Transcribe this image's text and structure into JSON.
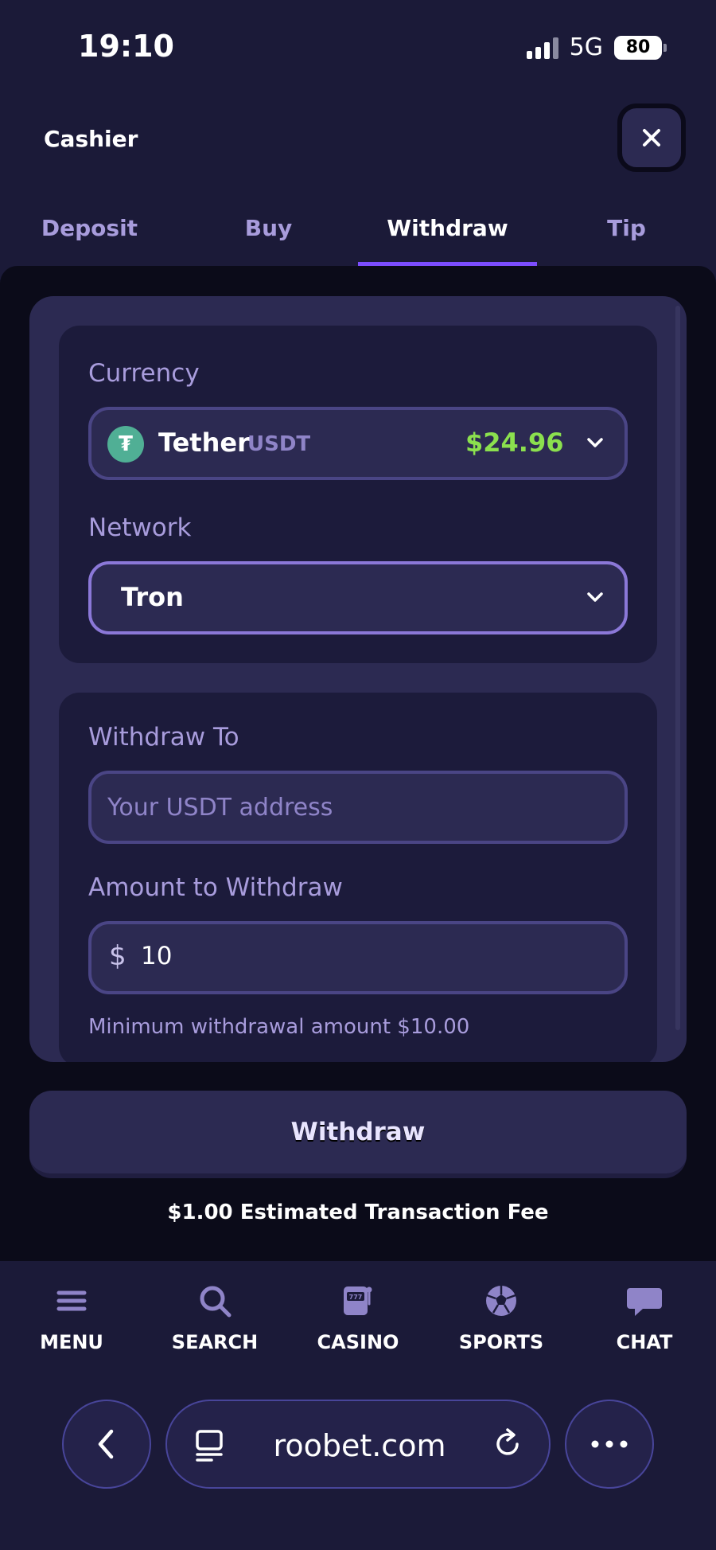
{
  "status_bar": {
    "time": "19:10",
    "network": "5G",
    "battery": "80"
  },
  "header": {
    "title": "Cashier"
  },
  "tabs": [
    {
      "label": "Deposit",
      "active": false
    },
    {
      "label": "Buy",
      "active": false
    },
    {
      "label": "Withdraw",
      "active": true
    },
    {
      "label": "Tip",
      "active": false
    }
  ],
  "currency": {
    "label": "Currency",
    "icon": "tether-icon",
    "icon_glyph": "₮",
    "name": "Tether",
    "ticker": "USDT",
    "balance": "$24.96"
  },
  "network": {
    "label": "Network",
    "value": "Tron"
  },
  "withdraw_to": {
    "label": "Withdraw To",
    "placeholder": "Your USDT address"
  },
  "amount": {
    "label": "Amount to Withdraw",
    "currency_symbol": "$",
    "value": "10"
  },
  "hint": "Minimum withdrawal amount $10.00",
  "withdraw_button": "Withdraw",
  "fee_text": "$1.00 Estimated Transaction Fee",
  "bottom_nav": [
    {
      "label": "MENU",
      "icon": "menu-icon"
    },
    {
      "label": "SEARCH",
      "icon": "search-icon"
    },
    {
      "label": "CASINO",
      "icon": "slot-machine-icon"
    },
    {
      "label": "SPORTS",
      "icon": "soccer-ball-icon"
    },
    {
      "label": "CHAT",
      "icon": "chat-icon"
    }
  ],
  "browser": {
    "url": "roobet.com"
  },
  "colors": {
    "background": "#1b1a38",
    "accent": "#7c4dff",
    "balance_green": "#8be04e",
    "tether_green": "#50af95",
    "label_purple": "#a89cdc"
  }
}
